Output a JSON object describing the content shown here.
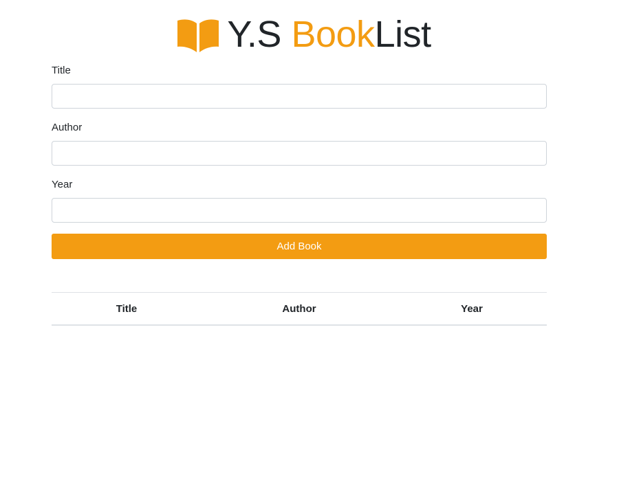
{
  "brand": {
    "icon": "book-open-icon",
    "prefix": "Y.S ",
    "accent": "Book",
    "suffix": "List",
    "accent_color": "#f39c12",
    "text_color": "#212529"
  },
  "form": {
    "title_label": "Title",
    "title_value": "",
    "author_label": "Author",
    "author_value": "",
    "year_label": "Year",
    "year_value": "",
    "submit_label": "Add Book",
    "submit_color": "#f39c12"
  },
  "table": {
    "headers": [
      "Title",
      "Author",
      "Year"
    ],
    "rows": []
  }
}
